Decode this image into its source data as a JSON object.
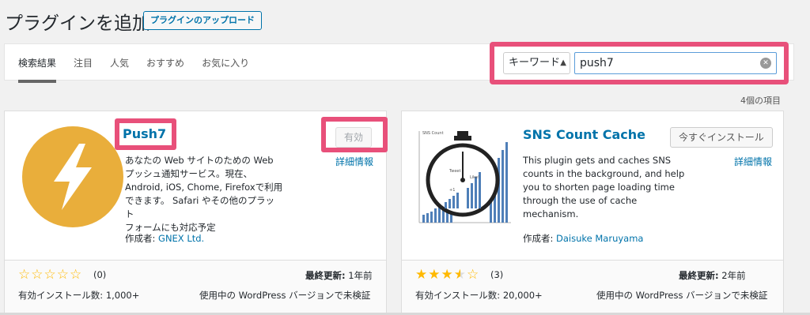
{
  "header": {
    "title": "プラグインを追加",
    "upload_button": "プラグインのアップロード"
  },
  "filter": {
    "tabs": [
      {
        "label": "検索結果",
        "current": true
      },
      {
        "label": "注目",
        "current": false
      },
      {
        "label": "人気",
        "current": false
      },
      {
        "label": "おすすめ",
        "current": false
      },
      {
        "label": "お気に入り",
        "current": false
      }
    ],
    "search_type": "キーワード",
    "search_value": "push7"
  },
  "item_count": "4個の項目",
  "plugins": [
    {
      "name": "Push7",
      "button": "有効",
      "details": "詳細情報",
      "description": [
        "あなたの Web サイトのための Web",
        "プッシュ通知サービス。現在、",
        "Android, iOS, Chome, Firefoxで利用",
        "できます。 Safari やその他のプラット",
        "フォームにも対応予定"
      ],
      "author_label": "作成者:",
      "author": "GNEX Ltd.",
      "rating": 0,
      "rating_count": "(0)",
      "last_updated_label": "最終更新:",
      "last_updated": "1年前",
      "installs_label": "有効インストール数:",
      "installs": "1,000+",
      "compat": "使用中の WordPress バージョンで未検証",
      "icon_color": "#e9ae3b"
    },
    {
      "name": "SNS Count Cache",
      "button": "今すぐインストール",
      "details": "詳細情報",
      "description": [
        "This plugin gets and caches SNS",
        "counts in the background, and help",
        "you to shorten page loading time",
        "through the use of cache",
        "mechanism."
      ],
      "author_label": "作成者:",
      "author": "Daisuke Maruyama",
      "rating": 3.5,
      "rating_count": "(3)",
      "last_updated_label": "最終更新:",
      "last_updated": "2年前",
      "installs_label": "有効インストール数:",
      "installs": "20,000+",
      "compat": "使用中の WordPress バージョンで未検証",
      "icon_labels": [
        "SNS Count",
        "Tweet",
        "Like!",
        "+1"
      ]
    }
  ],
  "colors": {
    "link": "#0073aa",
    "highlight": "#e8507a",
    "star": "#ffb900"
  }
}
